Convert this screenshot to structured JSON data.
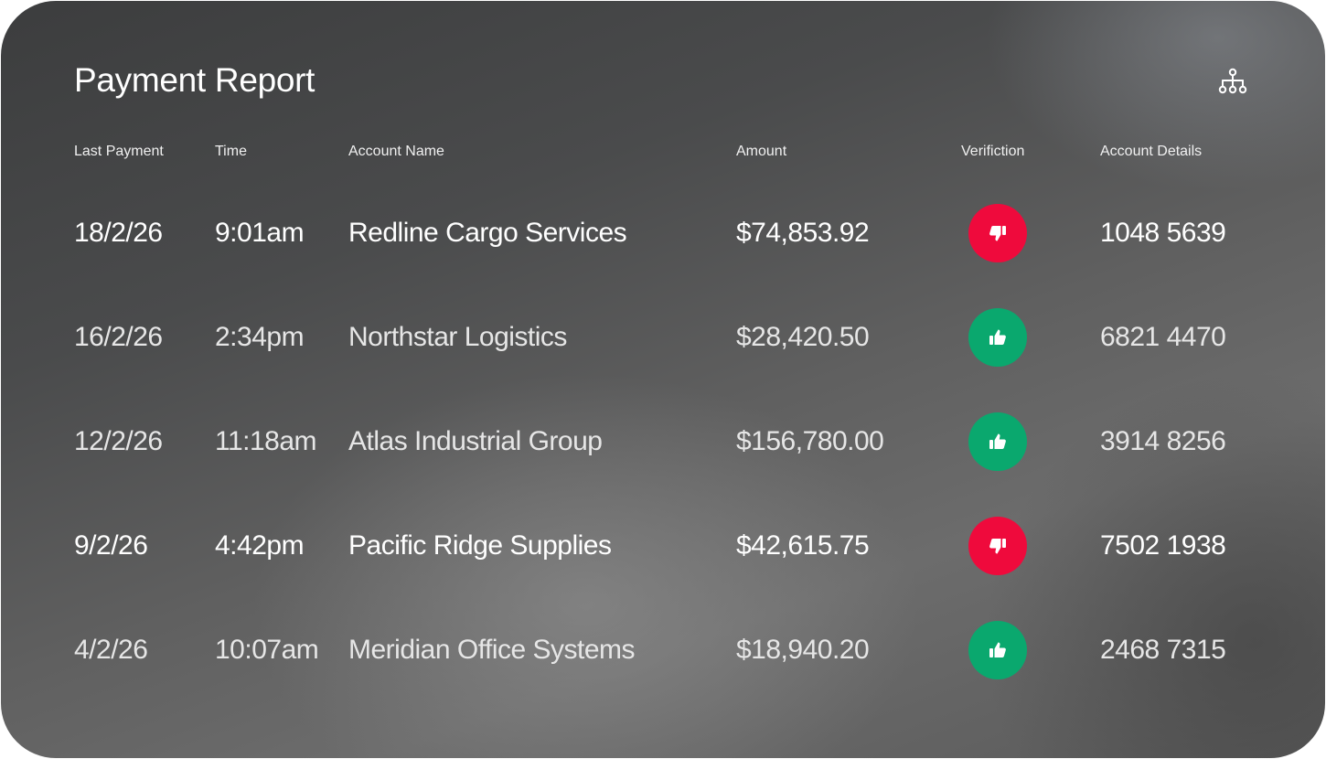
{
  "report": {
    "title": "Payment Report"
  },
  "columns": {
    "last_payment": "Last Payment",
    "time": "Time",
    "account_name": "Account Name",
    "amount": "Amount",
    "verification": "Verifiction",
    "account_details": "Account Details"
  },
  "icons": {
    "header_action": "hierarchy-icon",
    "verified": "thumbs-up-icon",
    "rejected": "thumbs-down-icon"
  },
  "colors": {
    "verified": "#0aa86e",
    "rejected": "#ef0a3c"
  },
  "rows": [
    {
      "date": "18/2/26",
      "time": "9:01am",
      "name": "Redline Cargo Services",
      "amount": "$74,853.92",
      "verified": false,
      "account": "1048 5639"
    },
    {
      "date": "16/2/26",
      "time": "2:34pm",
      "name": "Northstar Logistics",
      "amount": "$28,420.50",
      "verified": true,
      "account": "6821 4470"
    },
    {
      "date": "12/2/26",
      "time": "11:18am",
      "name": "Atlas Industrial Group",
      "amount": "$156,780.00",
      "verified": true,
      "account": "3914 8256"
    },
    {
      "date": "9/2/26",
      "time": "4:42pm",
      "name": "Pacific Ridge Supplies",
      "amount": "$42,615.75",
      "verified": false,
      "account": "7502 1938"
    },
    {
      "date": "4/2/26",
      "time": "10:07am",
      "name": "Meridian Office Systems",
      "amount": "$18,940.20",
      "verified": true,
      "account": "2468 7315"
    }
  ]
}
